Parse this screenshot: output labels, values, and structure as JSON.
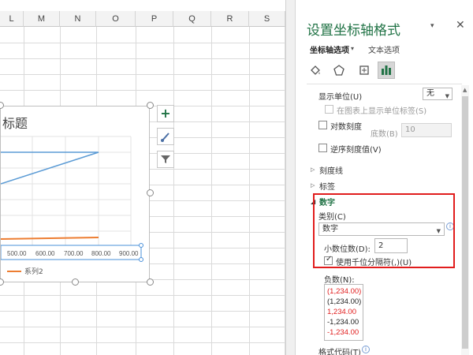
{
  "sheet": {
    "columns": [
      "L",
      "M",
      "N",
      "O",
      "P",
      "Q",
      "R",
      "S"
    ]
  },
  "chart": {
    "title_partial": "标题",
    "x_tick_labels": [
      "500.00",
      "600.00",
      "700.00",
      "800.00",
      "900.00"
    ],
    "legend_label": "系列2",
    "series_colors": {
      "series1": "#5b9bd5",
      "series2": "#ed7d31"
    },
    "tools": [
      "chart-elements",
      "chart-styles",
      "chart-filters"
    ]
  },
  "pane": {
    "title": "设置坐标轴格式",
    "tabs": {
      "axis_options": "坐标轴选项",
      "text_options": "文本选项"
    },
    "icons": [
      "fill-line-icon",
      "effects-pentagon-icon",
      "size-properties-icon",
      "axis-options-bar-icon"
    ],
    "display_units": {
      "label": "显示单位(U)",
      "value": "无"
    },
    "show_unit_label": "在图表上显示单位标签(S)",
    "log_scale": {
      "label": "对数刻度",
      "base_label": "底数(B)",
      "base_value": "10"
    },
    "reverse_order": "逆序刻度值(V)",
    "sections": {
      "tick_marks": "刻度线",
      "labels": "标签",
      "number": "数字"
    },
    "number": {
      "category_label": "类别(C)",
      "category_value": "数字",
      "decimal_label": "小数位数(D):",
      "decimal_value": "2",
      "thousands_label": "使用千位分隔符(,)(U)",
      "negative_label": "负数(N):",
      "negative_options": [
        {
          "text": "(1,234.00)",
          "color": "#e11d1d"
        },
        {
          "text": "(1,234.00)",
          "color": "#222222"
        },
        {
          "text": "1,234.00",
          "color": "#e11d1d"
        },
        {
          "text": "-1,234.00",
          "color": "#222222"
        },
        {
          "text": "-1,234.00",
          "color": "#e11d1d"
        }
      ],
      "format_code_label": "格式代码(T)"
    }
  },
  "colors": {
    "accent_green": "#217346",
    "highlight_red": "#e11d1d"
  }
}
